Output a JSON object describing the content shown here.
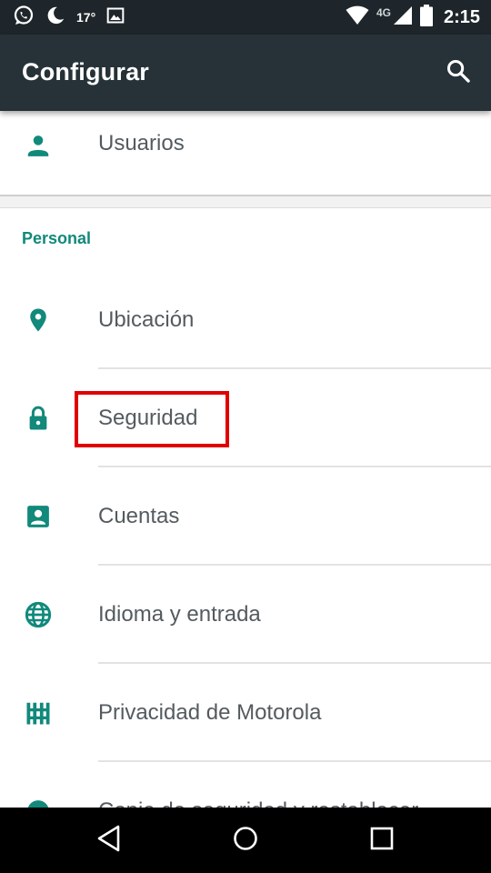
{
  "status_bar": {
    "temperature": "17°",
    "network": "4G",
    "time": "2:15",
    "icons": [
      "whatsapp-icon",
      "moon-icon",
      "image-icon",
      "wifi-icon",
      "signal-icon",
      "battery-icon"
    ]
  },
  "app_bar": {
    "title": "Configurar",
    "search_icon": "search-icon"
  },
  "top_item": {
    "label": "Usuarios",
    "icon": "person-icon"
  },
  "section": {
    "header": "Personal"
  },
  "items": [
    {
      "label": "Ubicación",
      "icon": "location-pin-icon"
    },
    {
      "label": "Seguridad",
      "icon": "lock-icon",
      "highlighted": true
    },
    {
      "label": "Cuentas",
      "icon": "account-box-icon"
    },
    {
      "label": "Idioma y entrada",
      "icon": "globe-icon"
    },
    {
      "label": "Privacidad de Motorola",
      "icon": "fence-icon"
    },
    {
      "label": "Copia de seguridad y restablecer",
      "icon": "backup-icon"
    }
  ],
  "colors": {
    "status_bar": "#1e262b",
    "app_bar": "#263238",
    "accent": "#11897b",
    "highlight": "#e00000"
  },
  "nav_bar": {
    "icons": [
      "back-icon",
      "home-icon",
      "recents-icon"
    ]
  }
}
